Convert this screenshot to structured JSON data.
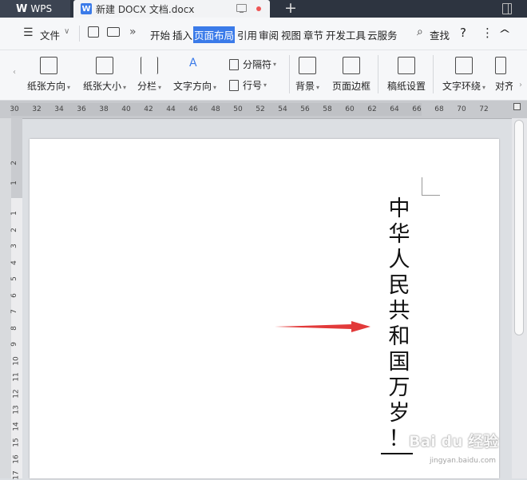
{
  "titlebar": {
    "app_name": "WPS",
    "document_title": "新建 DOCX 文档.docx"
  },
  "menubar": {
    "file_label": "文件",
    "more_label": "»",
    "tabs": [
      "开始",
      "插入",
      "页面布局",
      "引用",
      "审阅",
      "视图",
      "章节",
      "开发工具",
      "云服务"
    ],
    "active_tab": "页面布局",
    "search_label": "查找",
    "help_label": "?",
    "menu_dots": "⋮",
    "collapse_label": "^"
  },
  "ribbon": {
    "orientation": "纸张方向",
    "size": "纸张大小",
    "columns": "分栏",
    "text_direction": "文字方向",
    "separator": "分隔符",
    "line_numbers": "行号",
    "background": "背景",
    "page_border": "页面边框",
    "manuscript": "稿纸设置",
    "text_wrap": "文字环绕",
    "align": "对齐"
  },
  "ruler": {
    "h_ticks": [
      "30",
      "32",
      "34",
      "36",
      "38",
      "40",
      "42",
      "44",
      "46",
      "48",
      "50",
      "52",
      "54",
      "56",
      "58",
      "60",
      "62",
      "64",
      "66",
      "68",
      "70",
      "72"
    ],
    "v_ticks_top": [
      "2",
      "1"
    ],
    "v_ticks": [
      "1",
      "2",
      "3",
      "4",
      "5",
      "6",
      "7",
      "8",
      "9",
      "10",
      "11",
      "12",
      "13",
      "14",
      "15",
      "16",
      "17"
    ]
  },
  "document": {
    "text_chars": [
      "中",
      "华",
      "人",
      "民",
      "共",
      "和",
      "国",
      "万",
      "岁",
      "！"
    ]
  },
  "watermark": {
    "main": "Bai du 经验",
    "sub": "jingyan.baidu.com"
  },
  "colors": {
    "accent": "#3b7be9",
    "arrow": "#e23a3a",
    "titlebar": "#2d3440"
  }
}
